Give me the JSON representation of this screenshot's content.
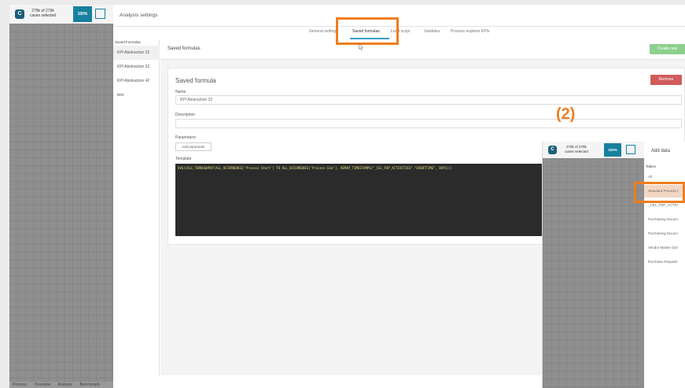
{
  "background_app": {
    "cases_line1": "279k of 279k",
    "cases_line2": "cases selected",
    "percent": "100%",
    "bottom_tabs": [
      "Process",
      "Overview",
      "Analysis",
      "Benchmark"
    ]
  },
  "modal": {
    "title": "Analysis settings",
    "tabs": [
      {
        "label": "General settings",
        "active": false
      },
      {
        "label": "Saved formulas",
        "active": true
      },
      {
        "label": "Load script",
        "active": false
      },
      {
        "label": "Variables",
        "active": false
      },
      {
        "label": "Process explorer KPIs",
        "active": false
      }
    ],
    "sidebar": {
      "heading": "Saved Formulas",
      "items": [
        "KPI Abstraction 22",
        "KPI Abstraction 32",
        "KPI Abstraction 42",
        "test"
      ]
    },
    "content_title": "Saved formulas",
    "create_label": "Create new",
    "card": {
      "title": "Saved formula",
      "remove_label": "Remove",
      "name_label": "Name",
      "name_value": "KPI Abstraction 22",
      "description_label": "Description",
      "description_value": "",
      "parameters_label": "Parameters",
      "add_parameter_label": "Add parameter",
      "template_label": "Template",
      "template_code": "AVG(CALC_THROUGHPUT(ALL_OCCURRENCE['Process Start'] TO ALL_OCCURRENCE['Process End'], REMAP_TIMESTAMPS(\"_CEL_P2P_ACTIVITIES\".\"EVENTTIME\", DAYS)))"
    }
  },
  "annotation_label": "(2)",
  "inset": {
    "cases_line1": "279k of 279k",
    "cases_line2": "cases selected",
    "percent": "100%",
    "title": "Add data",
    "tables_label": "Tables",
    "items": [
      {
        "label": "All",
        "selected": false
      },
      {
        "label": "Standard Process (",
        "selected": true
      },
      {
        "label": "_CEL_P2P_ACTIV",
        "selected": false
      },
      {
        "label": "Purchasing Docum",
        "selected": false
      },
      {
        "label": "Purchasing Docum",
        "selected": false
      },
      {
        "label": "Vendor Master (Ge",
        "selected": false
      },
      {
        "label": "Purchase Requisiti",
        "selected": false
      }
    ]
  },
  "colors": {
    "accent": "#17809f",
    "highlight": "#f07d1f",
    "create": "#8ed08e",
    "remove": "#d05c5c"
  }
}
